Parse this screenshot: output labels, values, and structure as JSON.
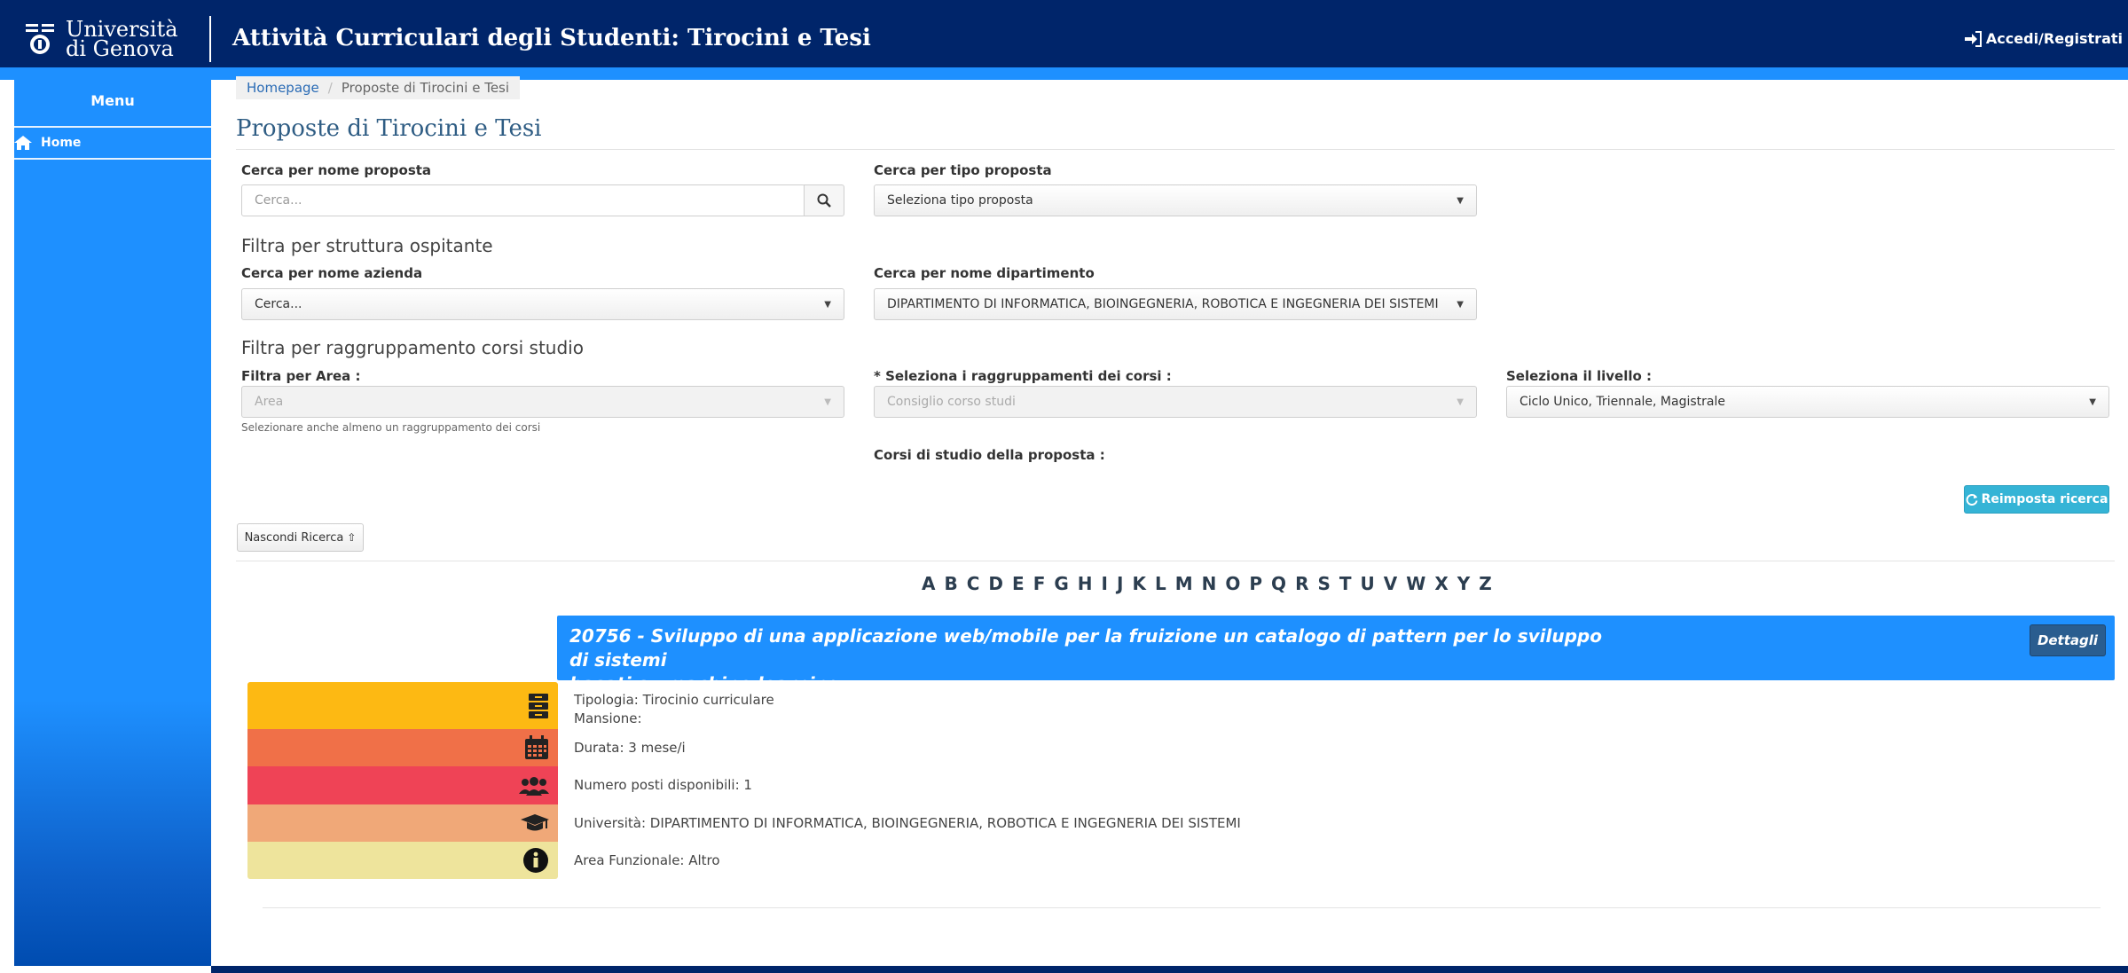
{
  "header": {
    "logo_line1": "Università",
    "logo_line2": "di Genova",
    "title": "Attività Curriculari degli Studenti: Tirocini e Tesi",
    "login_label": "Accedi/Registrati"
  },
  "sidebar": {
    "menu_title": "Menu",
    "items": [
      {
        "label": "Home",
        "icon": "home-icon"
      }
    ]
  },
  "breadcrumb": {
    "home": "Homepage",
    "current": "Proposte di Tirocini e Tesi"
  },
  "page_title": "Proposte di Tirocini e Tesi",
  "search": {
    "name_label": "Cerca per nome proposta",
    "name_placeholder": "Cerca...",
    "type_label": "Cerca per tipo proposta",
    "type_value": "Seleziona tipo proposta",
    "host_heading": "Filtra per struttura ospitante",
    "company_label": "Cerca per nome azienda",
    "company_value": "Cerca...",
    "department_label": "Cerca per nome dipartimento",
    "department_value": "DIPARTIMENTO DI INFORMATICA, BIOINGEGNERIA, ROBOTICA E INGEGNERIA DEI SISTEMI",
    "group_heading": "Filtra per raggruppamento corsi studio",
    "area_label": "Filtra per Area :",
    "area_value": "Area",
    "area_help": "Selezionare anche almeno un raggruppamento dei corsi",
    "groups_label": "* Seleziona i raggruppamenti dei corsi :",
    "groups_value": "Consiglio corso studi",
    "level_label": "Seleziona il livello :",
    "level_value": "Ciclo Unico, Triennale, Magistrale",
    "courses_label": "Corsi di studio della proposta :",
    "reset_label": "Reimposta ricerca",
    "hide_label": "Nascondi Ricerca"
  },
  "alphabet": [
    "A",
    "B",
    "C",
    "D",
    "E",
    "F",
    "G",
    "H",
    "I",
    "J",
    "K",
    "L",
    "M",
    "N",
    "O",
    "P",
    "Q",
    "R",
    "S",
    "T",
    "U",
    "V",
    "W",
    "X",
    "Y",
    "Z"
  ],
  "proposal": {
    "title_line1": "20756 - Sviluppo di una applicazione web/mobile per la fruizione un catalogo di pattern per lo sviluppo di sistemi",
    "title_line2": "basati su machine learning",
    "details_label": "Dettagli",
    "tipologia": "Tipologia: Tirocinio curriculare",
    "mansione": "Mansione:",
    "durata": "Durata: 3 mese/i",
    "posti": "Numero posti disponibili: 1",
    "universita": "Università: DIPARTIMENTO DI INFORMATICA, BIOINGEGNERIA, ROBOTICA E INGEGNERIA DEI SISTEMI",
    "area": "Area Funzionale: Altro"
  },
  "colors": {
    "header_bg": "#00256a",
    "accent": "#1e90ff",
    "stripe_type": "#fdb913",
    "stripe_duration": "#f07048",
    "stripe_seats": "#ef4356",
    "stripe_university": "#f0a878",
    "stripe_area": "#eee49c"
  }
}
